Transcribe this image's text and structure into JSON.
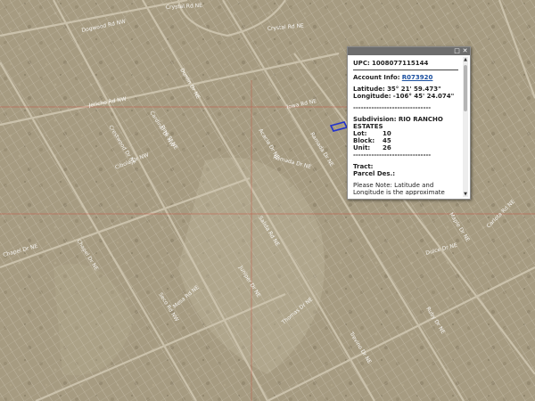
{
  "map": {
    "colors": {
      "ground": "#a59a80",
      "parcel_line": "#d8d2c4",
      "road": "#cfc6b0",
      "red_line": "#c84a3a",
      "highlight": "#2233cc"
    },
    "streets": [
      "Crystal Rd NE",
      "Crystal Rd NE",
      "Dogwood Rd NW",
      "Jericho Rd NW",
      "Iowa Rd NE",
      "Dunlin Dr NE",
      "Crestwood Dr NE",
      "Cardinal Dr NW",
      "Pine St NE",
      "Acacia Dr NE",
      "Cibola Dr NW",
      "Ramada Dr NE",
      "Ramada Dr NE",
      "Salida Rd NE",
      "Chapel Dr NE",
      "Chapel Dr NE",
      "Mesa Rd NE",
      "Seco Rd NW",
      "Juniper Dr NE",
      "Thomas Dr NE",
      "Trevino Dr NE",
      "Ruby Dr NE",
      "Dulce Dr NE",
      "Maple Dr NE",
      "Carlota Rd NE"
    ]
  },
  "popup": {
    "maximize_icon": "window-maximize-icon",
    "close_icon": "close-icon",
    "upc_label": "UPC:",
    "upc_value": "1008077115144",
    "account_label": "Account Info:",
    "account_value": "R073920",
    "latitude_label": "Latitude:",
    "latitude_value": "35° 21' 59.473\"",
    "longitude_label": "Longitude:",
    "longitude_value": "-106° 45' 24.074\"",
    "divider": "------------------------------",
    "subdivision_label": "Subdivision:",
    "subdivision_value": "RIO RANCHO ESTATES",
    "lot_label": "Lot:",
    "lot_value": "10",
    "block_label": "Block:",
    "block_value": "45",
    "unit_label": "Unit:",
    "unit_value": "26",
    "tract_label": "Tract:",
    "parcel_label": "Parcel Des.:",
    "note": "Please Note: Latitude and Longitude is the approximate center of the parcel shown."
  }
}
